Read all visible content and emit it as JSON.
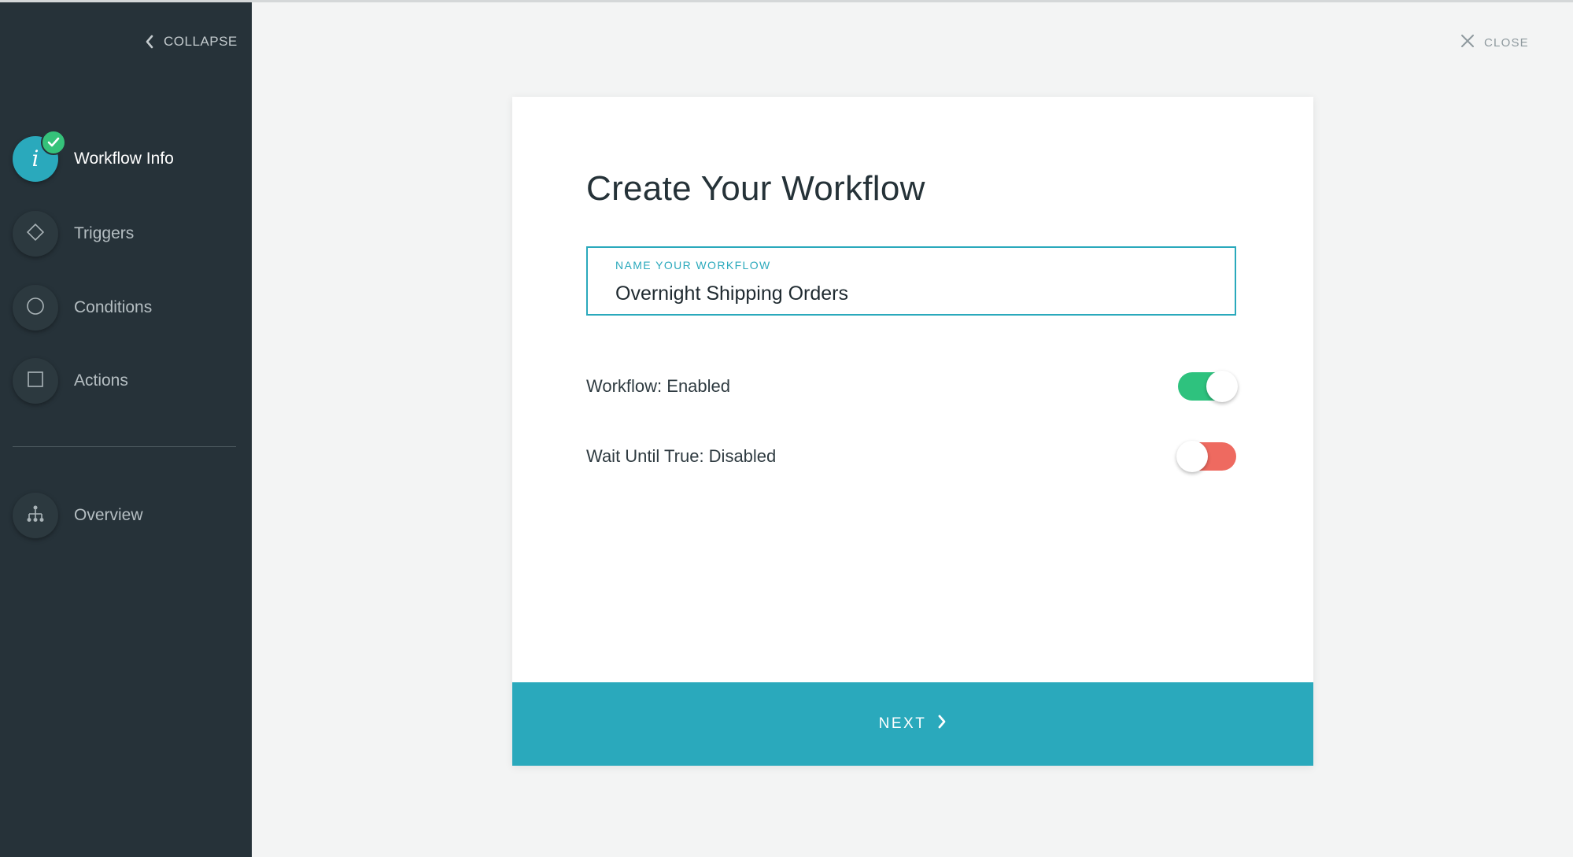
{
  "sidebar": {
    "collapse_label": "COLLAPSE",
    "steps": [
      {
        "label": "Workflow Info",
        "icon": "info-icon",
        "active": true,
        "completed": true
      },
      {
        "label": "Triggers",
        "icon": "diamond-icon",
        "active": false
      },
      {
        "label": "Conditions",
        "icon": "circle-icon",
        "active": false
      },
      {
        "label": "Actions",
        "icon": "square-icon",
        "active": false
      }
    ],
    "overview": {
      "label": "Overview",
      "icon": "hierarchy-icon"
    }
  },
  "header": {
    "close_label": "CLOSE"
  },
  "card": {
    "title": "Create Your Workflow",
    "name_field": {
      "label": "NAME YOUR WORKFLOW",
      "value": "Overnight Shipping Orders"
    },
    "toggles": [
      {
        "label": "Workflow: Enabled",
        "state": "on"
      },
      {
        "label": "Wait Until True: Disabled",
        "state": "off"
      }
    ],
    "next_label": "NEXT"
  },
  "colors": {
    "sidebar_bg": "#263239",
    "accent": "#2aa9bc",
    "toggle_on": "#2ec27e",
    "toggle_off": "#ee6a60",
    "check": "#35c27a"
  }
}
